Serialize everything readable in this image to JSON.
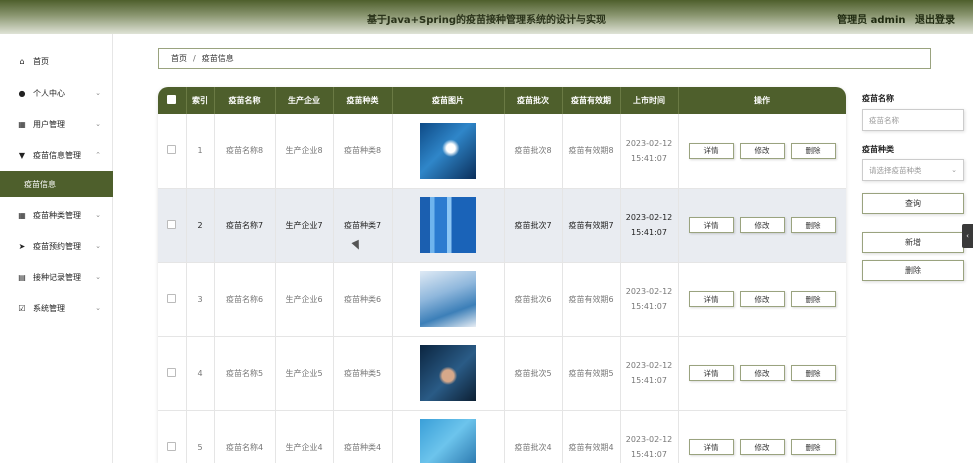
{
  "header": {
    "title": "基于Java+Spring的疫苗接种管理系统的设计与实现",
    "user": "管理员 admin",
    "logout": "退出登录"
  },
  "sidebar": {
    "items": [
      {
        "label": "首页",
        "icon": "home-icon",
        "glyph": "⌂",
        "chevron": ""
      },
      {
        "label": "个人中心",
        "icon": "person-icon",
        "glyph": "●",
        "chevron": "⌄"
      },
      {
        "label": "用户管理",
        "icon": "grid-icon",
        "glyph": "▦",
        "chevron": "⌄"
      },
      {
        "label": "疫苗信息管理",
        "icon": "filter-icon",
        "glyph": "▼",
        "chevron": "⌃"
      },
      {
        "label": "疫苗信息",
        "icon": "",
        "glyph": "",
        "chevron": ""
      },
      {
        "label": "疫苗种类管理",
        "icon": "grid-icon",
        "glyph": "▦",
        "chevron": "⌄"
      },
      {
        "label": "疫苗预约管理",
        "icon": "send-icon",
        "glyph": "➤",
        "chevron": "⌄"
      },
      {
        "label": "接种记录管理",
        "icon": "clipboard-icon",
        "glyph": "▤",
        "chevron": "⌄"
      },
      {
        "label": "系统管理",
        "icon": "checklist-icon",
        "glyph": "☑",
        "chevron": "⌄"
      }
    ]
  },
  "breadcrumb": {
    "home": "首页",
    "sep": "/",
    "current": "疫苗信息"
  },
  "table": {
    "headers": [
      "",
      "索引",
      "疫苗名称",
      "生产企业",
      "疫苗种类",
      "疫苗图片",
      "疫苗批次",
      "疫苗有效期",
      "上市时间",
      "操作"
    ],
    "actions": {
      "detail": "详情",
      "edit": "修改",
      "delete": "删除"
    },
    "rows": [
      {
        "index": "1",
        "name": "疫苗名称8",
        "company": "生产企业8",
        "type": "疫苗种类8",
        "batch": "疫苗批次8",
        "validity": "疫苗有效期8",
        "date": "2023-02-12",
        "time": "15:41:07",
        "highlighted": false
      },
      {
        "index": "2",
        "name": "疫苗名称7",
        "company": "生产企业7",
        "type": "疫苗种类7",
        "batch": "疫苗批次7",
        "validity": "疫苗有效期7",
        "date": "2023-02-12",
        "time": "15:41:07",
        "highlighted": true
      },
      {
        "index": "3",
        "name": "疫苗名称6",
        "company": "生产企业6",
        "type": "疫苗种类6",
        "batch": "疫苗批次6",
        "validity": "疫苗有效期6",
        "date": "2023-02-12",
        "time": "15:41:07",
        "highlighted": false
      },
      {
        "index": "4",
        "name": "疫苗名称5",
        "company": "生产企业5",
        "type": "疫苗种类5",
        "batch": "疫苗批次5",
        "validity": "疫苗有效期5",
        "date": "2023-02-12",
        "time": "15:41:07",
        "highlighted": false
      },
      {
        "index": "5",
        "name": "疫苗名称4",
        "company": "生产企业4",
        "type": "疫苗种类4",
        "batch": "疫苗批次4",
        "validity": "疫苗有效期4",
        "date": "2023-02-12",
        "time": "15:41:07",
        "highlighted": false
      }
    ]
  },
  "filter": {
    "name_label": "疫苗名称",
    "name_placeholder": "疫苗名称",
    "type_label": "疫苗种类",
    "type_placeholder": "请选择疫苗种类",
    "search": "查询",
    "add": "新增",
    "delete": "删除"
  },
  "colors": {
    "accent": "#4e5f2c",
    "row_highlight": "#e9ecf1"
  }
}
